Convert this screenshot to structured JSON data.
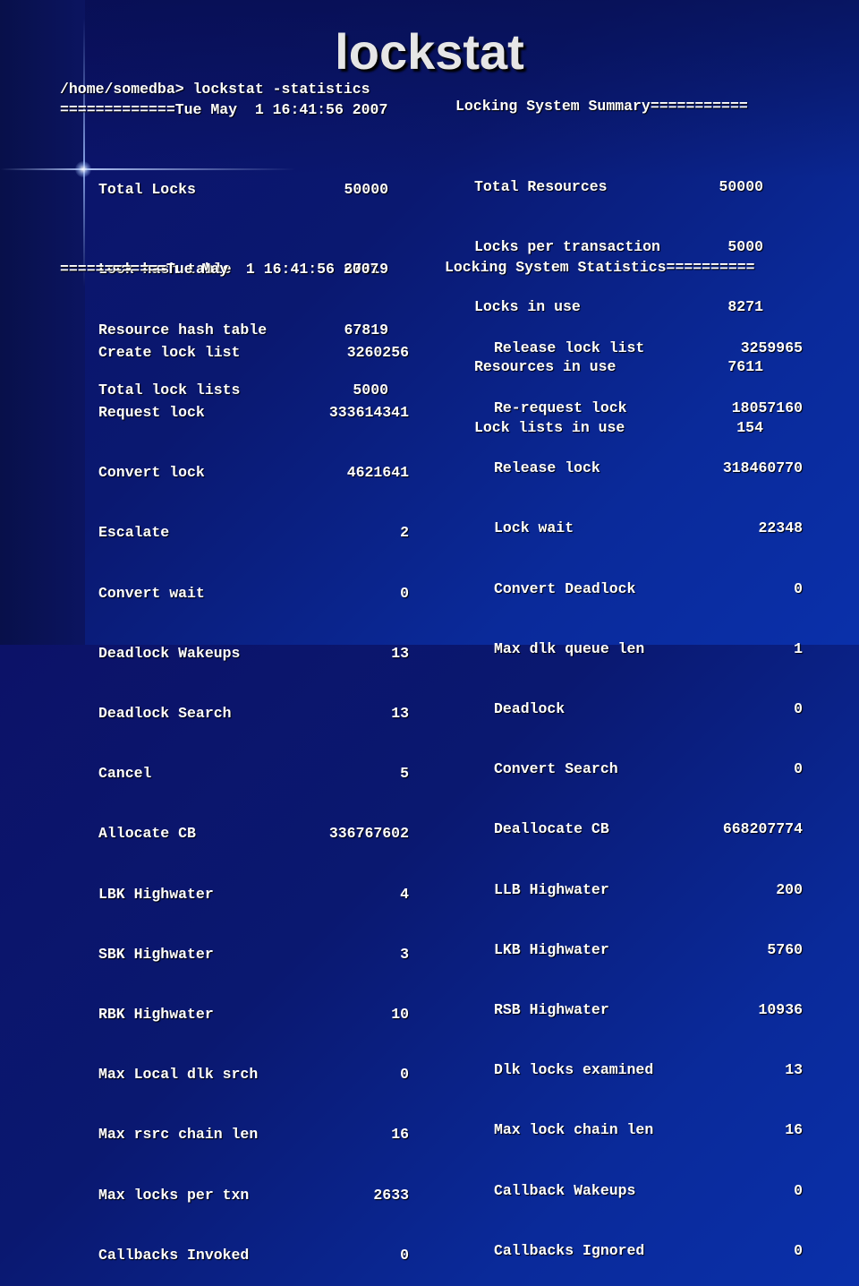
{
  "title": "lockstat",
  "terminal": {
    "command_line": "/home/somedba> lockstat -statistics",
    "header1": "=============Tue May  1 16:41:56 2007",
    "header2": "============Tue May  1 16:41:56 2007"
  },
  "config": [
    {
      "label": "Total Locks",
      "value": "50000"
    },
    {
      "label": "Lock hash table",
      "value": "67819"
    },
    {
      "label": "Resource hash table",
      "value": "67819"
    },
    {
      "label": "Total lock lists",
      "value": "5000"
    }
  ],
  "summary": {
    "header": "Locking System Summary===========",
    "rows": [
      {
        "label": "Total Resources",
        "value": "50000"
      },
      {
        "label": "Locks per transaction",
        "value": "5000"
      },
      {
        "label": "Locks in use",
        "value": "8271"
      },
      {
        "label": "Resources in use",
        "value": "7611"
      },
      {
        "label": "Lock lists in use",
        "value": "154"
      }
    ]
  },
  "statistics_left": [
    {
      "label": "Create lock list",
      "value": "3260256"
    },
    {
      "label": "Request lock",
      "value": "333614341"
    },
    {
      "label": "Convert lock",
      "value": "4621641"
    },
    {
      "label": "Escalate",
      "value": "2"
    },
    {
      "label": "Convert wait",
      "value": "0"
    },
    {
      "label": "Deadlock Wakeups",
      "value": "13"
    },
    {
      "label": "Deadlock Search",
      "value": "13"
    },
    {
      "label": "Cancel",
      "value": "5"
    },
    {
      "label": "Allocate CB",
      "value": "336767602"
    },
    {
      "label": "LBK Highwater",
      "value": "4"
    },
    {
      "label": "SBK Highwater",
      "value": "3"
    },
    {
      "label": "RBK Highwater",
      "value": "10"
    },
    {
      "label": "Max Local dlk srch",
      "value": "0"
    },
    {
      "label": "Max rsrc chain len",
      "value": "16"
    },
    {
      "label": "Max locks per txn",
      "value": "2633"
    },
    {
      "label": "Callbacks Invoked",
      "value": "0"
    }
  ],
  "statistics": {
    "header": "Locking System Statistics==========",
    "rows": [
      {
        "label": "Release lock list",
        "value": "3259965"
      },
      {
        "label": "Re-request lock",
        "value": "18057160"
      },
      {
        "label": "Release lock",
        "value": "318460770"
      },
      {
        "label": "Lock wait",
        "value": "22348"
      },
      {
        "label": "Convert Deadlock",
        "value": "0"
      },
      {
        "label": "Max dlk queue len",
        "value": "1"
      },
      {
        "label": "Deadlock",
        "value": "0"
      },
      {
        "label": "Convert Search",
        "value": "0"
      },
      {
        "label": "Deallocate CB",
        "value": "668207774"
      },
      {
        "label": "LLB Highwater",
        "value": "200"
      },
      {
        "label": "LKB Highwater",
        "value": "5760"
      },
      {
        "label": "RSB Highwater",
        "value": "10936"
      },
      {
        "label": "Dlk locks examined",
        "value": "13"
      },
      {
        "label": "Max lock chain len",
        "value": "16"
      },
      {
        "label": "Callback Wakeups",
        "value": "0"
      },
      {
        "label": "Callbacks Ignored",
        "value": "0"
      }
    ]
  }
}
